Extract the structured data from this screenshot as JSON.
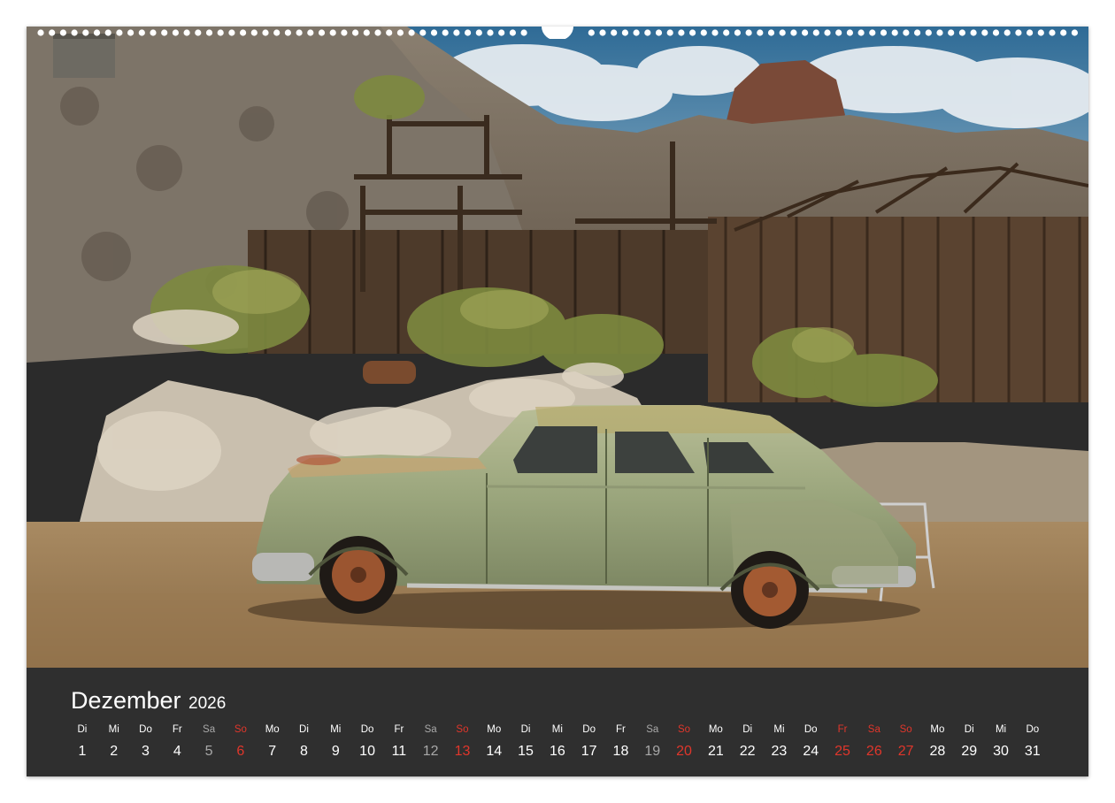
{
  "calendar": {
    "month": "Dezember",
    "year": "2026"
  },
  "days": [
    {
      "name": "Di",
      "num": "1",
      "kind": "weekday"
    },
    {
      "name": "Mi",
      "num": "2",
      "kind": "weekday"
    },
    {
      "name": "Do",
      "num": "3",
      "kind": "weekday"
    },
    {
      "name": "Fr",
      "num": "4",
      "kind": "weekday"
    },
    {
      "name": "Sa",
      "num": "5",
      "kind": "sat"
    },
    {
      "name": "So",
      "num": "6",
      "kind": "sun"
    },
    {
      "name": "Mo",
      "num": "7",
      "kind": "weekday"
    },
    {
      "name": "Di",
      "num": "8",
      "kind": "weekday"
    },
    {
      "name": "Mi",
      "num": "9",
      "kind": "weekday"
    },
    {
      "name": "Do",
      "num": "10",
      "kind": "weekday"
    },
    {
      "name": "Fr",
      "num": "11",
      "kind": "weekday"
    },
    {
      "name": "Sa",
      "num": "12",
      "kind": "sat"
    },
    {
      "name": "So",
      "num": "13",
      "kind": "sun"
    },
    {
      "name": "Mo",
      "num": "14",
      "kind": "weekday"
    },
    {
      "name": "Di",
      "num": "15",
      "kind": "weekday"
    },
    {
      "name": "Mi",
      "num": "16",
      "kind": "weekday"
    },
    {
      "name": "Do",
      "num": "17",
      "kind": "weekday"
    },
    {
      "name": "Fr",
      "num": "18",
      "kind": "weekday"
    },
    {
      "name": "Sa",
      "num": "19",
      "kind": "sat"
    },
    {
      "name": "So",
      "num": "20",
      "kind": "sun"
    },
    {
      "name": "Mo",
      "num": "21",
      "kind": "weekday"
    },
    {
      "name": "Di",
      "num": "22",
      "kind": "weekday"
    },
    {
      "name": "Mi",
      "num": "23",
      "kind": "weekday"
    },
    {
      "name": "Do",
      "num": "24",
      "kind": "weekday"
    },
    {
      "name": "Fr",
      "num": "25",
      "kind": "holiday"
    },
    {
      "name": "Sa",
      "num": "26",
      "kind": "holiday"
    },
    {
      "name": "So",
      "num": "27",
      "kind": "sun"
    },
    {
      "name": "Mo",
      "num": "28",
      "kind": "weekday"
    },
    {
      "name": "Di",
      "num": "29",
      "kind": "weekday"
    },
    {
      "name": "Mi",
      "num": "30",
      "kind": "weekday"
    },
    {
      "name": "Do",
      "num": "31",
      "kind": "weekday"
    }
  ],
  "colors": {
    "panel": "#2f2f2f",
    "sunday_holiday": "#e0362b",
    "saturday": "#a8a8a8",
    "text": "#ffffff"
  },
  "photo": {
    "subject": "vintage-green-sedan-at-abandoned-mine"
  }
}
